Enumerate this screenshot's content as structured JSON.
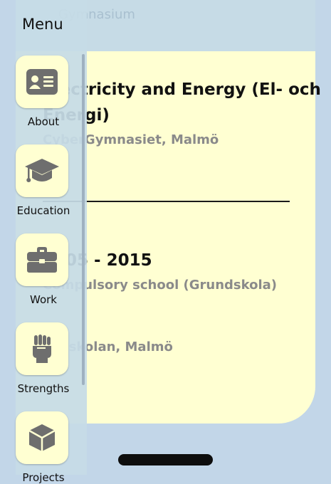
{
  "menu": {
    "title": "Menu",
    "items": [
      {
        "label": "About",
        "icon": "id-card-icon"
      },
      {
        "label": "Education",
        "icon": "graduation-cap-icon"
      },
      {
        "label": "Work",
        "icon": "briefcase-icon"
      },
      {
        "label": "Strengths",
        "icon": "fist-icon"
      },
      {
        "label": "Projects",
        "icon": "cube-icon"
      }
    ]
  },
  "education": {
    "faded_school": "Gymnasium",
    "entry1": {
      "program_line1": "Electricity and Energy (El- och",
      "program_line2": "Energi)",
      "school": "CyberGymnasiet, Malmö"
    },
    "entry2": {
      "years": "2005 - 2015",
      "type": "Compulsory school (Grundskola)",
      "school": "Rasskolan, Malmö"
    }
  },
  "colors": {
    "card": "#ffffd2",
    "background": "#c2d6e8",
    "icon": "#6e6e6e"
  }
}
